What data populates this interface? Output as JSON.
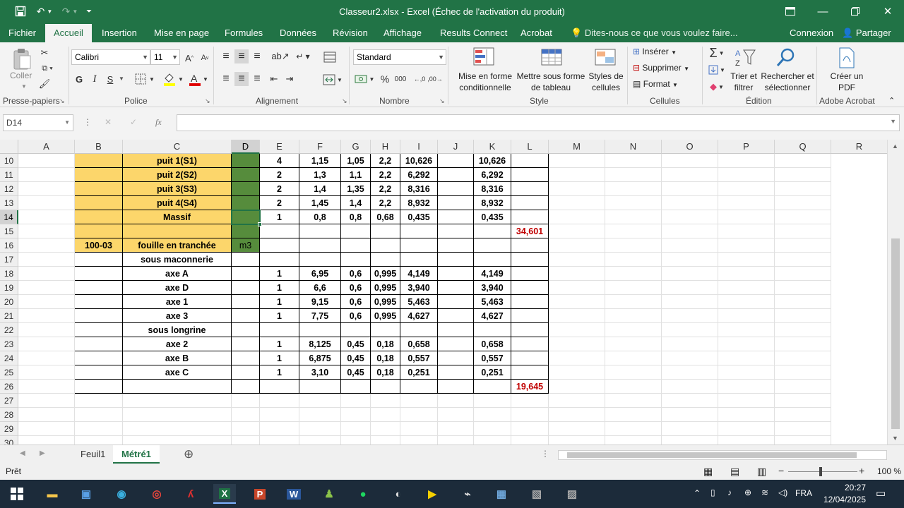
{
  "titlebar": {
    "title": "Classeur2.xlsx - Excel (Échec de l'activation du produit)",
    "restore_icon": "□"
  },
  "tabs": {
    "items": [
      "Fichier",
      "Accueil",
      "Insertion",
      "Mise en page",
      "Formules",
      "Données",
      "Révision",
      "Affichage",
      "Results Connect",
      "Acrobat"
    ],
    "active": "Accueil",
    "tell_me": "Dites-nous ce que vous voulez faire...",
    "connexion": "Connexion",
    "partager": "Partager"
  },
  "ribbon": {
    "clipboard": {
      "coller": "Coller",
      "label": "Presse-papiers"
    },
    "font": {
      "name": "Calibri",
      "size": "11",
      "bold": "G",
      "italic": "I",
      "underline": "S",
      "label": "Police"
    },
    "alignment": {
      "label": "Alignement"
    },
    "number": {
      "format": "Standard",
      "label": "Nombre",
      "percent": "%",
      "thousands": "000"
    },
    "style": {
      "conditional": "Mise en forme conditionnelle",
      "table": "Mettre sous forme de tableau",
      "cell_styles": "Styles de cellules",
      "label": "Style"
    },
    "cells": {
      "insert": "Insérer",
      "delete": "Supprimer",
      "format": "Format",
      "label": "Cellules"
    },
    "editing": {
      "sort": "Trier et filtrer",
      "find": "Rechercher et sélectionner",
      "label": "Édition"
    },
    "acrobat": {
      "create": "Créer un PDF",
      "label": "Adobe Acrobat"
    }
  },
  "formula_bar": {
    "name_box": "D14",
    "fx": "fx",
    "content": ""
  },
  "grid": {
    "columns": [
      "A",
      "B",
      "C",
      "D",
      "E",
      "F",
      "G",
      "H",
      "I",
      "J",
      "K",
      "L",
      "M",
      "N",
      "O",
      "P",
      "Q",
      "R"
    ],
    "selected_column": "D",
    "selected_row": "14",
    "rows": [
      {
        "n": "10",
        "B": "",
        "C": "puit 1(S1)",
        "D": "",
        "E": "4",
        "F": "1,15",
        "G": "1,05",
        "H": "2,2",
        "I": "10,626",
        "J": "",
        "K": "10,626",
        "L": ""
      },
      {
        "n": "11",
        "B": "",
        "C": "puit 2(S2)",
        "D": "",
        "E": "2",
        "F": "1,3",
        "G": "1,1",
        "H": "2,2",
        "I": "6,292",
        "J": "",
        "K": "6,292",
        "L": ""
      },
      {
        "n": "12",
        "B": "",
        "C": "puit 3(S3)",
        "D": "",
        "E": "2",
        "F": "1,4",
        "G": "1,35",
        "H": "2,2",
        "I": "8,316",
        "J": "",
        "K": "8,316",
        "L": ""
      },
      {
        "n": "13",
        "B": "",
        "C": "puit 4(S4)",
        "D": "",
        "E": "2",
        "F": "1,45",
        "G": "1,4",
        "H": "2,2",
        "I": "8,932",
        "J": "",
        "K": "8,932",
        "L": ""
      },
      {
        "n": "14",
        "B": "",
        "C": "Massif",
        "D": "",
        "E": "1",
        "F": "0,8",
        "G": "0,8",
        "H": "0,68",
        "I": "0,435",
        "J": "",
        "K": "0,435",
        "L": ""
      },
      {
        "n": "15",
        "B": "",
        "C": "",
        "D": "",
        "E": "",
        "F": "",
        "G": "",
        "H": "",
        "I": "",
        "J": "",
        "K": "",
        "L": "34,601"
      },
      {
        "n": "16",
        "B": "100-03",
        "C": "fouille en tranchée",
        "D": "m3",
        "E": "",
        "F": "",
        "G": "",
        "H": "",
        "I": "",
        "J": "",
        "K": "",
        "L": ""
      },
      {
        "n": "17",
        "B": "",
        "C": "sous maconnerie",
        "D": "",
        "E": "",
        "F": "",
        "G": "",
        "H": "",
        "I": "",
        "J": "",
        "K": "",
        "L": ""
      },
      {
        "n": "18",
        "B": "",
        "C": "axe A",
        "D": "",
        "E": "1",
        "F": "6,95",
        "G": "0,6",
        "H": "0,995",
        "I": "4,149",
        "J": "",
        "K": "4,149",
        "L": ""
      },
      {
        "n": "19",
        "B": "",
        "C": "axe D",
        "D": "",
        "E": "1",
        "F": "6,6",
        "G": "0,6",
        "H": "0,995",
        "I": "3,940",
        "J": "",
        "K": "3,940",
        "L": ""
      },
      {
        "n": "20",
        "B": "",
        "C": "axe 1",
        "D": "",
        "E": "1",
        "F": "9,15",
        "G": "0,6",
        "H": "0,995",
        "I": "5,463",
        "J": "",
        "K": "5,463",
        "L": ""
      },
      {
        "n": "21",
        "B": "",
        "C": "axe 3",
        "D": "",
        "E": "1",
        "F": "7,75",
        "G": "0,6",
        "H": "0,995",
        "I": "4,627",
        "J": "",
        "K": "4,627",
        "L": ""
      },
      {
        "n": "22",
        "B": "",
        "C": "sous longrine",
        "D": "",
        "E": "",
        "F": "",
        "G": "",
        "H": "",
        "I": "",
        "J": "",
        "K": "",
        "L": ""
      },
      {
        "n": "23",
        "B": "",
        "C": "axe 2",
        "D": "",
        "E": "1",
        "F": "8,125",
        "G": "0,45",
        "H": "0,18",
        "I": "0,658",
        "J": "",
        "K": "0,658",
        "L": ""
      },
      {
        "n": "24",
        "B": "",
        "C": "axe B",
        "D": "",
        "E": "1",
        "F": "6,875",
        "G": "0,45",
        "H": "0,18",
        "I": "0,557",
        "J": "",
        "K": "0,557",
        "L": ""
      },
      {
        "n": "25",
        "B": "",
        "C": "axe C",
        "D": "",
        "E": "1",
        "F": "3,10",
        "G": "0,45",
        "H": "0,18",
        "I": "0,251",
        "J": "",
        "K": "0,251",
        "L": ""
      },
      {
        "n": "26",
        "B": "",
        "C": "",
        "D": "",
        "E": "",
        "F": "",
        "G": "",
        "H": "",
        "I": "",
        "J": "",
        "K": "",
        "L": "19,645"
      },
      {
        "n": "27"
      },
      {
        "n": "28"
      },
      {
        "n": "29"
      },
      {
        "n": "30"
      }
    ]
  },
  "sheets": {
    "tabs": [
      "Feuil1",
      "Métré1"
    ],
    "active": "Métré1"
  },
  "status": {
    "ready": "Prêt",
    "zoom": "100 %"
  },
  "taskbar": {
    "lang": "FRA",
    "time": "20:27",
    "date": "12/04/2025"
  },
  "colors": {
    "excel_green": "#217346",
    "yellow_fill": "#fcd66b",
    "green_fill": "#568c3c",
    "total_red": "#c00000"
  }
}
